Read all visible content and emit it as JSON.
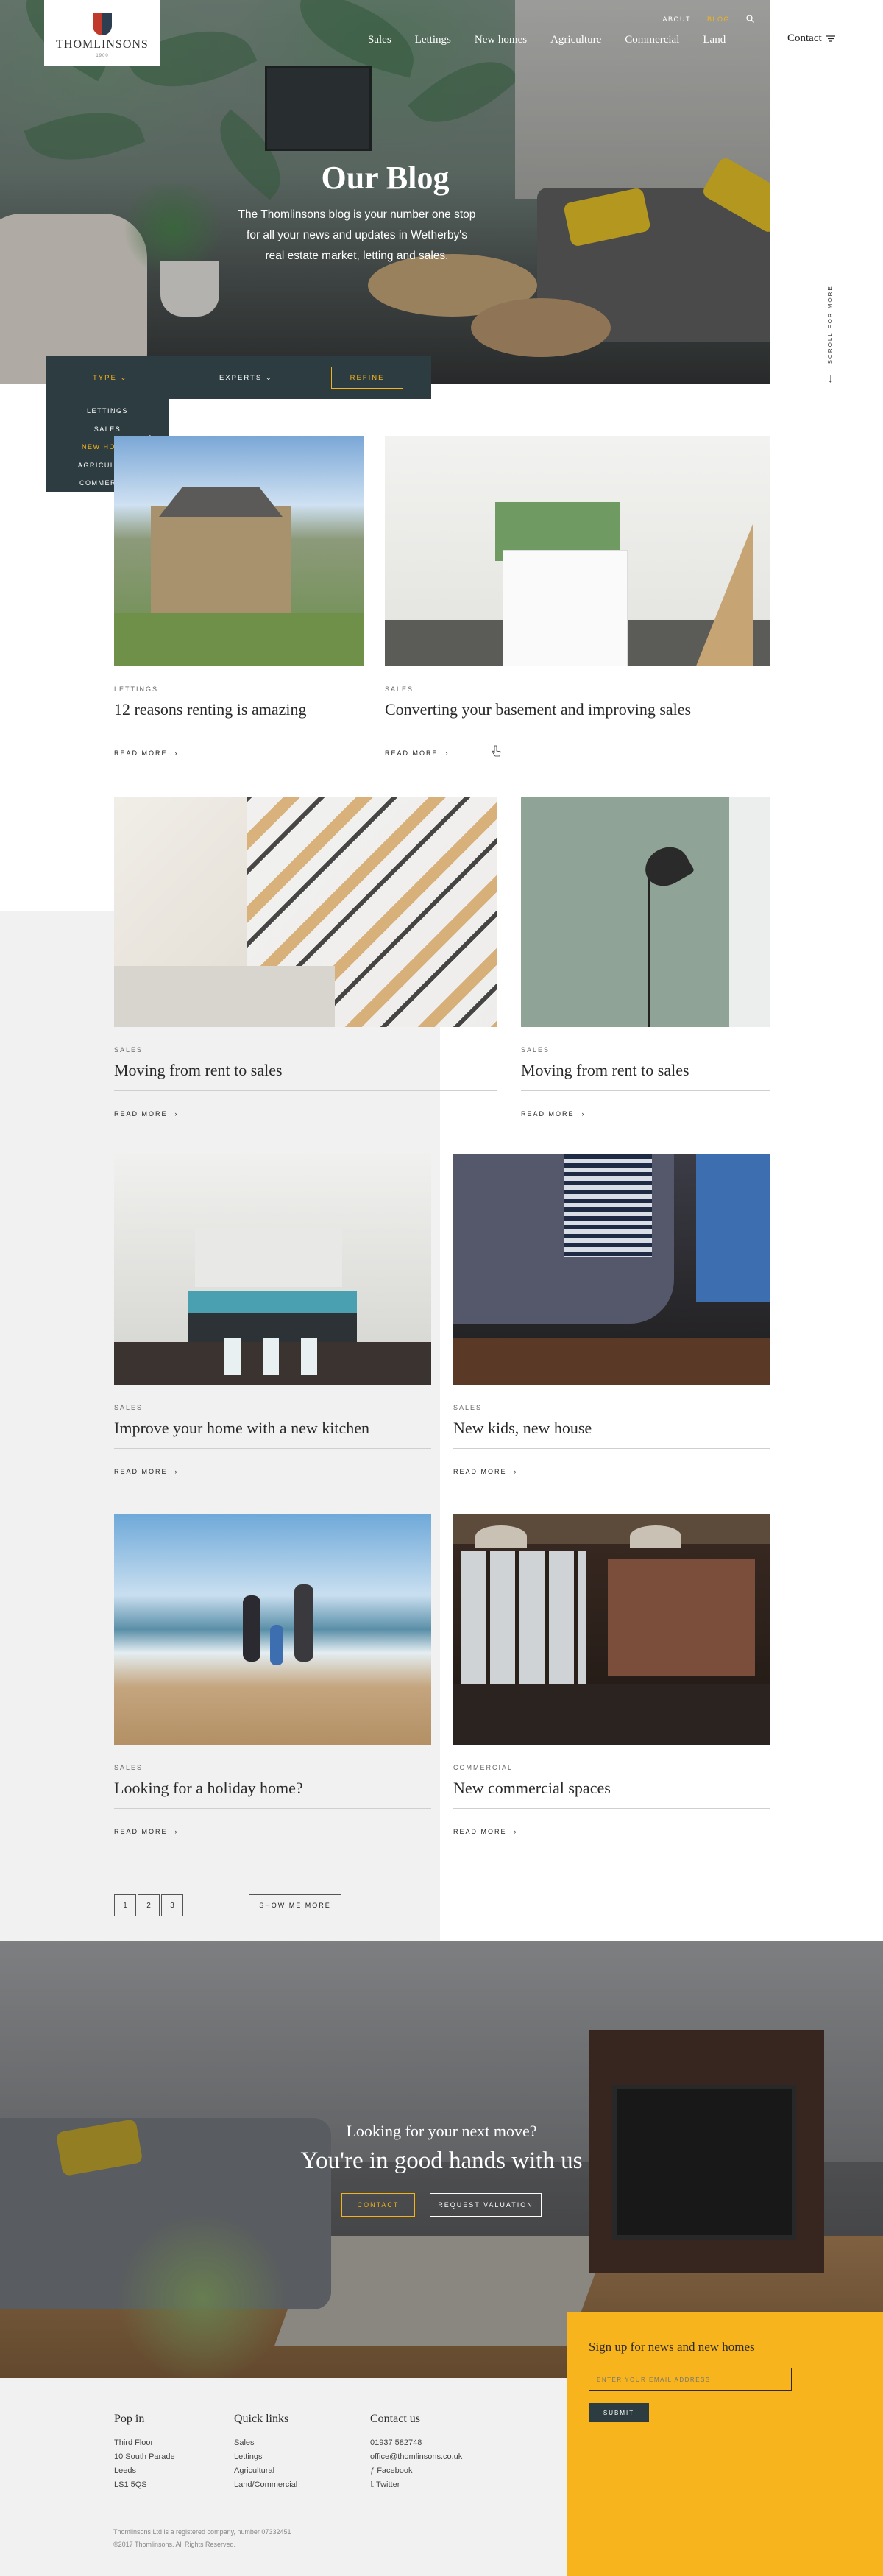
{
  "brand": {
    "name": "THOMLINSONS",
    "est": "1900"
  },
  "utility_nav": {
    "items": [
      "ABOUT",
      "BLOG"
    ],
    "active": "BLOG"
  },
  "main_nav": {
    "items": [
      "Sales",
      "Lettings",
      "New homes",
      "Agriculture",
      "Commercial",
      "Land"
    ],
    "contact_label": "Contact"
  },
  "hero": {
    "title": "Our Blog",
    "subtitle": "The Thomlinsons blog is your number one stop for all your news and updates in Wetherby's real estate market, letting and sales."
  },
  "scroll_label": "SCROLL FOR MORE",
  "filter": {
    "type_label": "TYPE",
    "experts_label": "EXPERTS",
    "refine_label": "REFINE",
    "type_options": [
      "LETTINGS",
      "SALES",
      "NEW HOMES",
      "AGRICULTURE",
      "COMMERCIAL"
    ],
    "type_selected": "NEW HOMES"
  },
  "posts": [
    {
      "category": "LETTINGS",
      "title": "12 reasons renting is amazing",
      "read_more": "READ MORE"
    },
    {
      "category": "SALES",
      "title": "Converting your basement and improving sales",
      "read_more": "READ MORE"
    },
    {
      "category": "SALES",
      "title": "Moving from rent to sales",
      "read_more": "READ MORE"
    },
    {
      "category": "SALES",
      "title": "Moving from rent to sales",
      "read_more": "READ MORE"
    },
    {
      "category": "SALES",
      "title": "Improve your home with a new kitchen",
      "read_more": "READ MORE"
    },
    {
      "category": "SALES",
      "title": "New kids, new house",
      "read_more": "READ MORE"
    },
    {
      "category": "SALES",
      "title": "Looking for a holiday home?",
      "read_more": "READ MORE"
    },
    {
      "category": "COMMERCIAL",
      "title": "New commercial spaces",
      "read_more": "READ MORE"
    }
  ],
  "pagination": {
    "pages": [
      "1",
      "2",
      "3"
    ],
    "show_more": "SHOW ME MORE"
  },
  "cta": {
    "question": "Looking for your next move?",
    "headline": "You're in good hands with us",
    "contact_button": "CONTACT",
    "valuation_button": "REQUEST VALUATION"
  },
  "footer": {
    "pop_in": {
      "heading": "Pop in",
      "lines": [
        "Third Floor",
        "10 South Parade",
        "Leeds",
        "LS1 5QS"
      ]
    },
    "quick_links": {
      "heading": "Quick links",
      "links": [
        "Sales",
        "Lettings",
        "Agricultural",
        "Land/Commercial"
      ]
    },
    "contact": {
      "heading": "Contact us",
      "phone": "01937 582748",
      "email": "office@thomlinsons.co.uk",
      "facebook": "Facebook",
      "twitter": "Twitter"
    },
    "signup": {
      "heading": "Sign up for news and new homes",
      "placeholder": "ENTER YOUR EMAIL ADDRESS",
      "submit": "SUBMIT"
    },
    "legal": [
      "Thomlinsons Ltd is a registered company, number 07332451",
      "©2017 Thomlinsons. All Rights Reserved."
    ]
  },
  "colors": {
    "accent": "#f4b31a",
    "dark": "#2d3c40",
    "grey_band": "#f1f1f1"
  }
}
